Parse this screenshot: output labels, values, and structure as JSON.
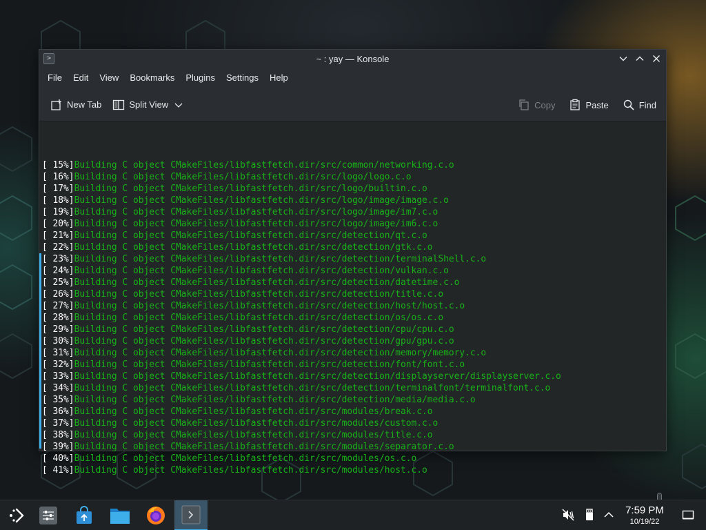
{
  "window": {
    "title": "~ : yay — Konsole"
  },
  "menubar": {
    "items": [
      "File",
      "Edit",
      "View",
      "Bookmarks",
      "Plugins",
      "Settings",
      "Help"
    ]
  },
  "toolbar": {
    "new_tab_label": "New Tab",
    "split_view_label": "Split View",
    "copy_label": "Copy",
    "paste_label": "Paste",
    "find_label": "Find"
  },
  "terminal": {
    "lines": [
      {
        "pct": "[ 15%]",
        "msg": "Building C object CMakeFiles/libfastfetch.dir/src/common/networking.c.o"
      },
      {
        "pct": "[ 16%]",
        "msg": "Building C object CMakeFiles/libfastfetch.dir/src/logo/logo.c.o"
      },
      {
        "pct": "[ 17%]",
        "msg": "Building C object CMakeFiles/libfastfetch.dir/src/logo/builtin.c.o"
      },
      {
        "pct": "[ 18%]",
        "msg": "Building C object CMakeFiles/libfastfetch.dir/src/logo/image/image.c.o"
      },
      {
        "pct": "[ 19%]",
        "msg": "Building C object CMakeFiles/libfastfetch.dir/src/logo/image/im7.c.o"
      },
      {
        "pct": "[ 20%]",
        "msg": "Building C object CMakeFiles/libfastfetch.dir/src/logo/image/im6.c.o"
      },
      {
        "pct": "[ 21%]",
        "msg": "Building C object CMakeFiles/libfastfetch.dir/src/detection/qt.c.o"
      },
      {
        "pct": "[ 22%]",
        "msg": "Building C object CMakeFiles/libfastfetch.dir/src/detection/gtk.c.o"
      },
      {
        "pct": "[ 23%]",
        "msg": "Building C object CMakeFiles/libfastfetch.dir/src/detection/terminalShell.c.o"
      },
      {
        "pct": "[ 24%]",
        "msg": "Building C object CMakeFiles/libfastfetch.dir/src/detection/vulkan.c.o"
      },
      {
        "pct": "[ 25%]",
        "msg": "Building C object CMakeFiles/libfastfetch.dir/src/detection/datetime.c.o"
      },
      {
        "pct": "[ 26%]",
        "msg": "Building C object CMakeFiles/libfastfetch.dir/src/detection/title.c.o"
      },
      {
        "pct": "[ 27%]",
        "msg": "Building C object CMakeFiles/libfastfetch.dir/src/detection/host/host.c.o"
      },
      {
        "pct": "[ 28%]",
        "msg": "Building C object CMakeFiles/libfastfetch.dir/src/detection/os/os.c.o"
      },
      {
        "pct": "[ 29%]",
        "msg": "Building C object CMakeFiles/libfastfetch.dir/src/detection/cpu/cpu.c.o"
      },
      {
        "pct": "[ 30%]",
        "msg": "Building C object CMakeFiles/libfastfetch.dir/src/detection/gpu/gpu.c.o"
      },
      {
        "pct": "[ 31%]",
        "msg": "Building C object CMakeFiles/libfastfetch.dir/src/detection/memory/memory.c.o"
      },
      {
        "pct": "[ 32%]",
        "msg": "Building C object CMakeFiles/libfastfetch.dir/src/detection/font/font.c.o"
      },
      {
        "pct": "[ 33%]",
        "msg": "Building C object CMakeFiles/libfastfetch.dir/src/detection/displayserver/displayserver.c.o"
      },
      {
        "pct": "[ 34%]",
        "msg": "Building C object CMakeFiles/libfastfetch.dir/src/detection/terminalfont/terminalfont.c.o"
      },
      {
        "pct": "[ 35%]",
        "msg": "Building C object CMakeFiles/libfastfetch.dir/src/detection/media/media.c.o"
      },
      {
        "pct": "[ 36%]",
        "msg": "Building C object CMakeFiles/libfastfetch.dir/src/modules/break.c.o"
      },
      {
        "pct": "[ 37%]",
        "msg": "Building C object CMakeFiles/libfastfetch.dir/src/modules/custom.c.o"
      },
      {
        "pct": "[ 38%]",
        "msg": "Building C object CMakeFiles/libfastfetch.dir/src/modules/title.c.o"
      },
      {
        "pct": "[ 39%]",
        "msg": "Building C object CMakeFiles/libfastfetch.dir/src/modules/separator.c.o"
      },
      {
        "pct": "[ 40%]",
        "msg": "Building C object CMakeFiles/libfastfetch.dir/src/modules/os.c.o"
      },
      {
        "pct": "[ 41%]",
        "msg": "Building C object CMakeFiles/libfastfetch.dir/src/modules/host.c.o"
      }
    ]
  },
  "taskbar": {
    "apps": [
      "application-launcher-icon",
      "system-settings-icon",
      "discover-store-icon",
      "file-manager-icon",
      "firefox-icon",
      "konsole-icon"
    ],
    "clock_time": "7:59 PM",
    "clock_date": "10/19/22"
  },
  "colors": {
    "accent": "#3daee9",
    "terminal_text_green": "#18b218",
    "terminal_bg": "#232627"
  }
}
